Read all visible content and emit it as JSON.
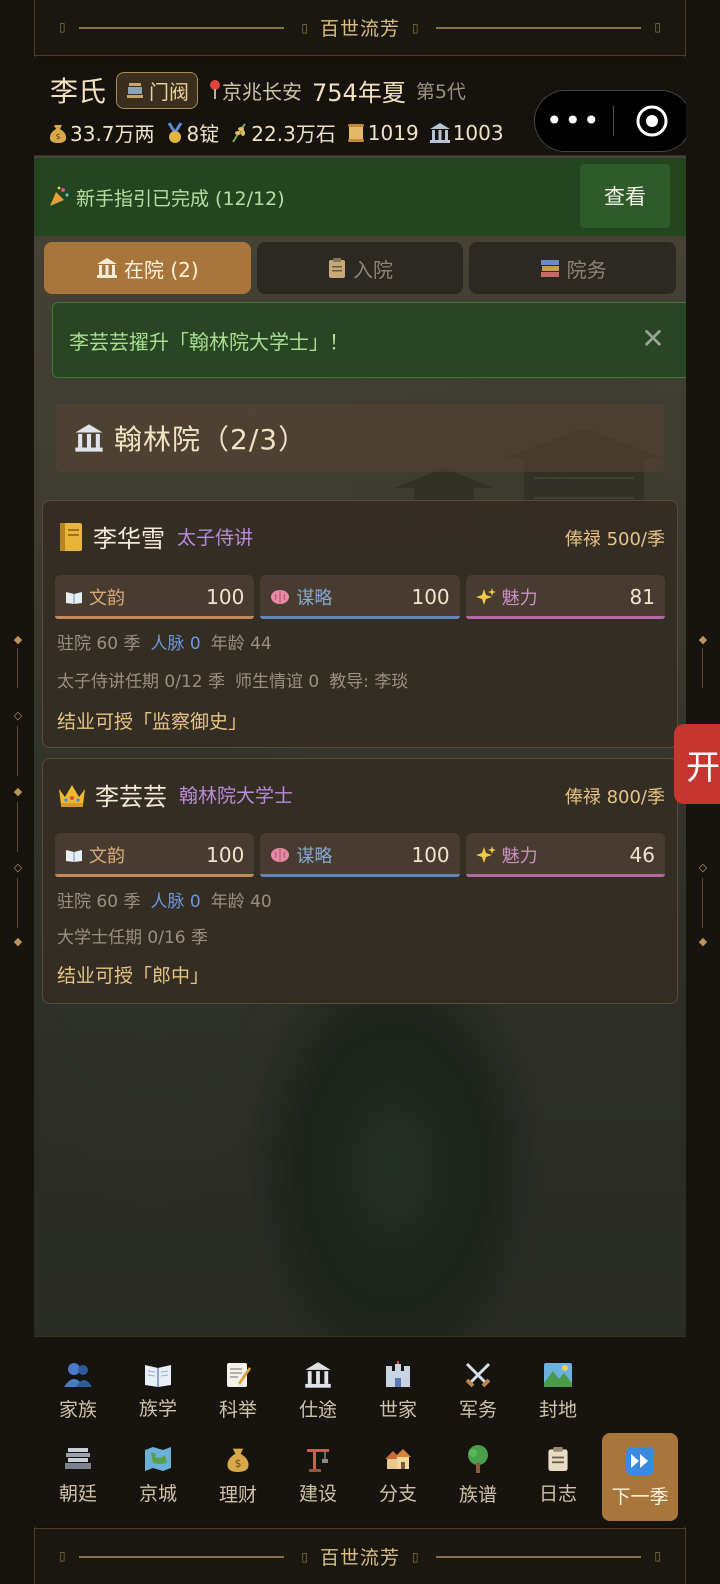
{
  "banner": {
    "title": "百世流芳"
  },
  "header": {
    "clan_name": "李氏",
    "rank_label": "门阀",
    "location": "京兆长安",
    "year_season": "754年夏",
    "generation": "第5代",
    "resources": {
      "silver": "33.7万两",
      "gold": "8锭",
      "grain": "22.3万石",
      "scrolls": "1019",
      "prestige": "1003"
    }
  },
  "guide": {
    "text": "新手指引已完成 (12/12)",
    "button": "查看"
  },
  "tabs": [
    {
      "label": "在院 (2)",
      "icon": "building-icon",
      "active": true
    },
    {
      "label": "入院",
      "icon": "clipboard-icon",
      "active": false
    },
    {
      "label": "院务",
      "icon": "books-icon",
      "active": false
    }
  ],
  "notice": {
    "text": "李芸芸擢升「翰林院大学士」！"
  },
  "section": {
    "title": "翰林院（2/3）"
  },
  "scholars": [
    {
      "name": "李华雪",
      "title": "太子侍讲",
      "salary": "俸禄 500/季",
      "stats": {
        "wen_label": "文韵",
        "wen": "100",
        "mou_label": "谋略",
        "mou": "100",
        "mei_label": "魅力",
        "mei": "81"
      },
      "stay": "驻院 60 季",
      "network": "人脉 0",
      "age": "年龄 44",
      "term": "太子侍讲任期 0/12 季",
      "mentor_bond": "师生情谊 0",
      "tutor": "教导: 李琰",
      "graduation": "结业可授「监察御史」"
    },
    {
      "name": "李芸芸",
      "title": "翰林院大学士",
      "salary": "俸禄 800/季",
      "stats": {
        "wen_label": "文韵",
        "wen": "100",
        "mou_label": "谋略",
        "mou": "100",
        "mei_label": "魅力",
        "mei": "46"
      },
      "stay": "驻院 60 季",
      "network": "人脉 0",
      "age": "年龄 40",
      "term": "大学士任期 0/16 季",
      "graduation": "结业可授「郎中」"
    }
  ],
  "nav": {
    "row1": [
      {
        "label": "家族",
        "icon": "family-icon"
      },
      {
        "label": "族学",
        "icon": "book-icon"
      },
      {
        "label": "科举",
        "icon": "memo-icon"
      },
      {
        "label": "仕途",
        "icon": "building-icon"
      },
      {
        "label": "世家",
        "icon": "castle-icon"
      },
      {
        "label": "军务",
        "icon": "swords-icon"
      },
      {
        "label": "封地",
        "icon": "landscape-icon"
      }
    ],
    "row2": [
      {
        "label": "朝廷",
        "icon": "court-icon"
      },
      {
        "label": "京城",
        "icon": "map-icon"
      },
      {
        "label": "理财",
        "icon": "money-bag-icon"
      },
      {
        "label": "建设",
        "icon": "crane-icon"
      },
      {
        "label": "分支",
        "icon": "houses-icon"
      },
      {
        "label": "族谱",
        "icon": "tree-icon"
      },
      {
        "label": "日志",
        "icon": "clipboard-icon"
      },
      {
        "label": "下一季",
        "icon": "fast-forward-icon"
      }
    ]
  },
  "edge_tab": {
    "label": "开"
  },
  "colors": {
    "accent": "#a8763a",
    "guide_green": "#24461f",
    "salary_gold": "#e6c384",
    "title_purple": "#b98bd8"
  }
}
